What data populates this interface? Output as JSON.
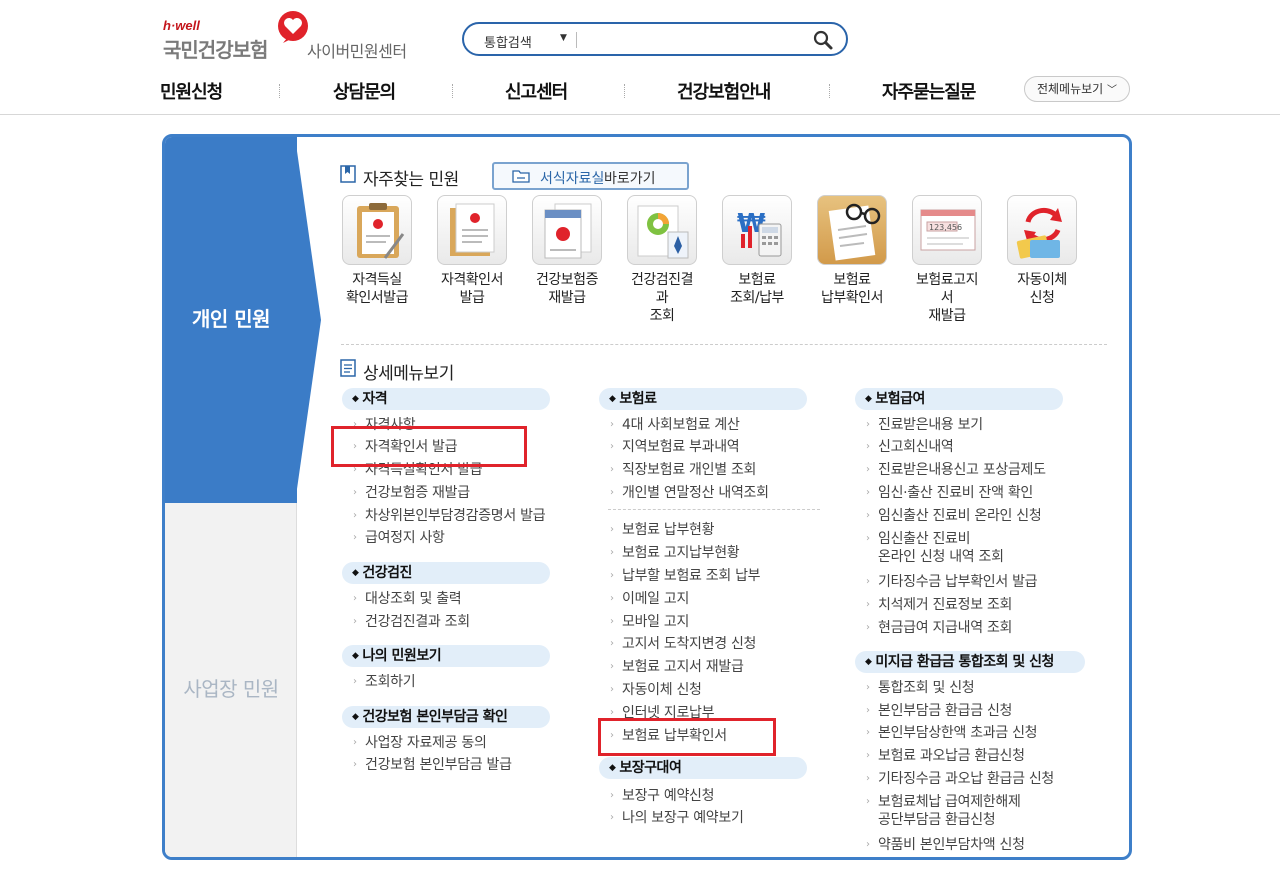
{
  "header": {
    "brand_tag": "h·well",
    "org_name": "국민건강보험",
    "center_name": "사이버민원센터",
    "search": {
      "scope": "통합검색",
      "placeholder": ""
    },
    "nav": [
      "민원신청",
      "상담문의",
      "신고센터",
      "건강보험안내",
      "자주묻는질문"
    ],
    "all_menu": "전체메뉴보기"
  },
  "sidebar": {
    "personal": "개인 민원",
    "business": "사업장 민원"
  },
  "frequent": {
    "title": "자주찾는 민원",
    "form_button": {
      "part1": "서식자료실",
      "part2": "바로가기"
    },
    "items": [
      {
        "label": "자격득실\n확인서발급",
        "icon": "clipboard-icon"
      },
      {
        "label": "자격확인서\n발급",
        "icon": "document-icon"
      },
      {
        "label": "건강보험증\n재발급",
        "icon": "insurance-card-icon"
      },
      {
        "label": "건강검진결\n과\n조회",
        "icon": "health-report-icon"
      },
      {
        "label": "보험료\n조회/납부",
        "icon": "won-calculator-icon"
      },
      {
        "label": "보험료\n납부확인서",
        "icon": "glasses-receipt-icon"
      },
      {
        "label": "보험료고지\n서\n재발급",
        "icon": "bill-icon"
      },
      {
        "label": "자동이체\n신청",
        "icon": "auto-transfer-icon"
      }
    ]
  },
  "detail": {
    "title": "상세메뉴보기",
    "col1": {
      "g1": {
        "title": "자격",
        "links": [
          "자격사항",
          "자격확인서 발급",
          "자격득실확인서 발급",
          "건강보험증 재발급",
          "차상위본인부담경감증명서 발급",
          "급여정지 사항"
        ]
      },
      "g2": {
        "title": "건강검진",
        "links": [
          "대상조회 및 출력",
          "건강검진결과 조회"
        ]
      },
      "g3": {
        "title": "나의 민원보기",
        "links": [
          "조회하기"
        ]
      },
      "g4": {
        "title": "건강보험 본인부담금 확인",
        "links": [
          "사업장 자료제공 동의",
          "건강보험 본인부담금 발급"
        ]
      }
    },
    "col2": {
      "g1": {
        "title": "보험료",
        "links": [
          "4대 사회보험료 계산",
          "지역보험료 부과내역",
          "직장보험료 개인별 조회",
          "개인별 연말정산 내역조회",
          "보험료 납부현황",
          "보험료 고지납부현황",
          "납부할 보험료 조회 납부",
          "이메일 고지",
          "모바일 고지",
          "고지서 도착지변경 신청",
          "보험료 고지서 재발급",
          "자동이체 신청",
          "인터넷 지로납부",
          "보험료 납부확인서"
        ]
      },
      "g2": {
        "title": "보장구대여",
        "links": [
          "보장구 예약신청",
          "나의 보장구 예약보기"
        ]
      }
    },
    "col3": {
      "g1": {
        "title": "보험급여",
        "links": [
          "진료받은내용 보기",
          "신고회신내역",
          "진료받은내용신고 포상금제도",
          "임신·출산 진료비 잔액 확인",
          "임신출산 진료비 온라인 신청",
          "임신출산 진료비\n온라인 신청 내역 조회",
          "기타징수금 납부확인서 발급",
          "치석제거 진료정보 조회",
          "현금급여 지급내역 조회"
        ]
      },
      "g2": {
        "title": "미지급 환급금 통합조회 및 신청",
        "links": [
          "통합조회 및 신청",
          "본인부담금 환급금 신청",
          "본인부담상한액 초과금 신청",
          "보험료 과오납금 환급신청",
          "기타징수금 과오납 환급금 신청",
          "보험료체납 급여제한해제\n공단부담금 환급신청",
          "약품비 본인부담차액 신청"
        ]
      }
    }
  }
}
